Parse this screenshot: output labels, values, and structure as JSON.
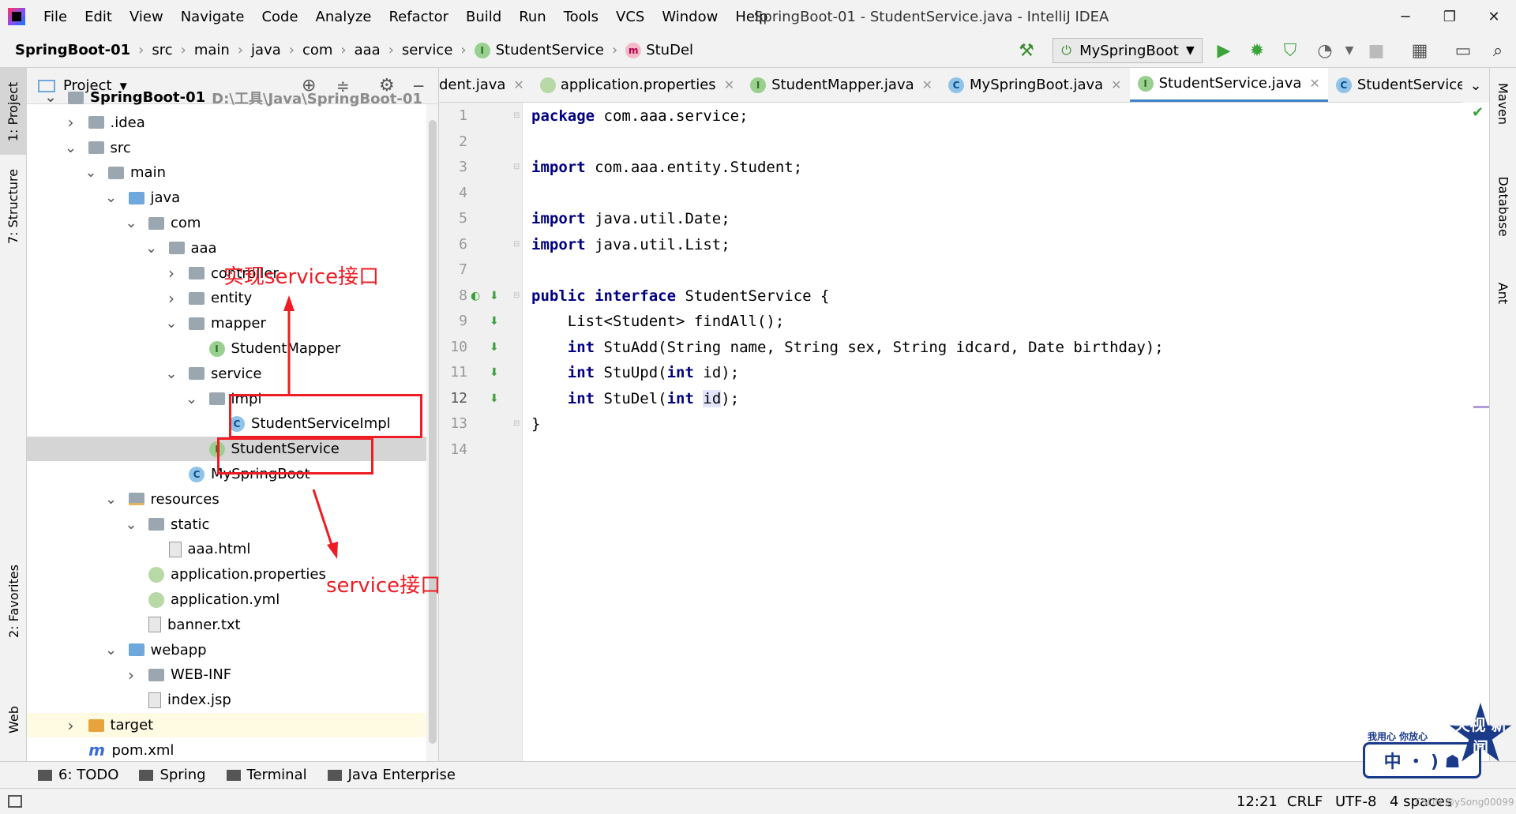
{
  "window": {
    "title": "SpringBoot-01 - StudentService.java - IntelliJ IDEA",
    "controls": {
      "minimize": "─",
      "maximize": "❐",
      "close": "✕"
    }
  },
  "menu": [
    "File",
    "Edit",
    "View",
    "Navigate",
    "Code",
    "Analyze",
    "Refactor",
    "Build",
    "Run",
    "Tools",
    "VCS",
    "Window",
    "Help"
  ],
  "breadcrumbs": {
    "project": "SpringBoot-01",
    "path": [
      "src",
      "main",
      "java",
      "com",
      "aaa",
      "service"
    ],
    "class": "StudentService",
    "method": "StuDel",
    "class_badge": "I",
    "method_badge": "m"
  },
  "toolbar": {
    "run_config": "MySpringBoot",
    "icons": [
      "hammer-icon",
      "run-icon",
      "debug-icon",
      "coverage-icon",
      "profile-icon",
      "stop-icon",
      "project-structure-icon",
      "layout-icon",
      "search-icon"
    ]
  },
  "left_tools": {
    "project": "1: Project",
    "structure": "7: Structure",
    "favorites": "2: Favorites",
    "web": "Web"
  },
  "right_tools": {
    "maven": "Maven",
    "database": "Database",
    "ant": "Ant"
  },
  "project_panel": {
    "title": "Project",
    "tree": [
      {
        "label": "SpringBoot-01",
        "hint": "D:\\工具\\Java\\SpringBoot-01",
        "depth": 0,
        "arrow": "open",
        "icon": "folder"
      },
      {
        "label": ".idea",
        "depth": 1,
        "arrow": "closed",
        "icon": "folder"
      },
      {
        "label": "src",
        "depth": 1,
        "arrow": "open",
        "icon": "folder"
      },
      {
        "label": "main",
        "depth": 2,
        "arrow": "open",
        "icon": "folder"
      },
      {
        "label": "java",
        "depth": 3,
        "arrow": "open",
        "icon": "folder-blue"
      },
      {
        "label": "com",
        "depth": 4,
        "arrow": "open",
        "icon": "folder"
      },
      {
        "label": "aaa",
        "depth": 5,
        "arrow": "open",
        "icon": "folder"
      },
      {
        "label": "controller",
        "depth": 6,
        "arrow": "closed",
        "icon": "folder"
      },
      {
        "label": "entity",
        "depth": 6,
        "arrow": "closed",
        "icon": "folder"
      },
      {
        "label": "mapper",
        "depth": 6,
        "arrow": "open",
        "icon": "folder"
      },
      {
        "label": "StudentMapper",
        "depth": 7,
        "arrow": "none",
        "icon": "interface",
        "badge": "I"
      },
      {
        "label": "service",
        "depth": 6,
        "arrow": "open",
        "icon": "folder"
      },
      {
        "label": "impl",
        "depth": 7,
        "arrow": "open",
        "icon": "folder"
      },
      {
        "label": "StudentServiceImpl",
        "depth": 8,
        "arrow": "none",
        "icon": "class",
        "badge": "C"
      },
      {
        "label": "StudentService",
        "depth": 7,
        "arrow": "none",
        "icon": "interface",
        "badge": "I",
        "selected": true
      },
      {
        "label": "MySpringBoot",
        "depth": 6,
        "arrow": "none",
        "icon": "class",
        "badge": "C"
      },
      {
        "label": "resources",
        "depth": 3,
        "arrow": "open",
        "icon": "folder-res"
      },
      {
        "label": "static",
        "depth": 4,
        "arrow": "open",
        "icon": "folder"
      },
      {
        "label": "aaa.html",
        "depth": 5,
        "arrow": "none",
        "icon": "file"
      },
      {
        "label": "application.properties",
        "depth": 4,
        "arrow": "none",
        "icon": "prop"
      },
      {
        "label": "application.yml",
        "depth": 4,
        "arrow": "none",
        "icon": "prop"
      },
      {
        "label": "banner.txt",
        "depth": 4,
        "arrow": "none",
        "icon": "file"
      },
      {
        "label": "webapp",
        "depth": 3,
        "arrow": "open",
        "icon": "folder-blue"
      },
      {
        "label": "WEB-INF",
        "depth": 4,
        "arrow": "closed",
        "icon": "folder"
      },
      {
        "label": "index.jsp",
        "depth": 4,
        "arrow": "none",
        "icon": "file"
      },
      {
        "label": "target",
        "depth": 1,
        "arrow": "closed",
        "icon": "folder-orange",
        "excluded": true
      },
      {
        "label": "pom.xml",
        "depth": 1,
        "arrow": "none",
        "icon": "xml"
      }
    ]
  },
  "editor_tabs": [
    {
      "label": "dent.java",
      "icon": "none"
    },
    {
      "label": "application.properties",
      "icon": "prop"
    },
    {
      "label": "StudentMapper.java",
      "icon": "interface",
      "badge": "I"
    },
    {
      "label": "MySpringBoot.java",
      "icon": "class",
      "badge": "C"
    },
    {
      "label": "StudentService.java",
      "icon": "interface",
      "badge": "I",
      "active": true
    },
    {
      "label": "StudentServiceImpl.java",
      "icon": "class",
      "badge": "C"
    }
  ],
  "code_lines": [
    {
      "n": "1",
      "parts": [
        [
          "kw",
          "package"
        ],
        [
          "t",
          " com.aaa.service;"
        ]
      ]
    },
    {
      "n": "2",
      "parts": []
    },
    {
      "n": "3",
      "parts": [
        [
          "kw",
          "import"
        ],
        [
          "t",
          " com.aaa.entity.Student;"
        ]
      ]
    },
    {
      "n": "4",
      "parts": []
    },
    {
      "n": "5",
      "parts": [
        [
          "kw",
          "import"
        ],
        [
          "t",
          " java.util.Date;"
        ]
      ]
    },
    {
      "n": "6",
      "parts": [
        [
          "kw",
          "import"
        ],
        [
          "t",
          " java.util.List;"
        ]
      ]
    },
    {
      "n": "7",
      "parts": []
    },
    {
      "n": "8",
      "parts": [
        [
          "kw",
          "public interface"
        ],
        [
          "t",
          " StudentService {"
        ]
      ]
    },
    {
      "n": "9",
      "parts": [
        [
          "t",
          "    List<Student> findAll();"
        ]
      ]
    },
    {
      "n": "10",
      "parts": [
        [
          "t",
          "    "
        ],
        [
          "kw",
          "int"
        ],
        [
          "t",
          " StuAdd(String name, String sex, String idcard, Date birthday);"
        ]
      ]
    },
    {
      "n": "11",
      "parts": [
        [
          "t",
          "    "
        ],
        [
          "kw",
          "int"
        ],
        [
          "t",
          " StuUpd("
        ],
        [
          "kw",
          "int"
        ],
        [
          "t",
          " id);"
        ]
      ]
    },
    {
      "n": "12",
      "parts": [
        [
          "t",
          "    "
        ],
        [
          "kw",
          "int"
        ],
        [
          "t",
          " StuDel("
        ],
        [
          "kw",
          "int"
        ],
        [
          "t",
          " "
        ],
        [
          "hl",
          "id"
        ],
        [
          "t",
          ");"
        ]
      ]
    },
    {
      "n": "13",
      "parts": [
        [
          "t",
          "}"
        ]
      ]
    },
    {
      "n": "14",
      "parts": []
    }
  ],
  "bottom_tools": [
    {
      "label": "6: TODO",
      "icon": "todo-icon"
    },
    {
      "label": "Spring",
      "icon": "spring-icon"
    },
    {
      "label": "Terminal",
      "icon": "terminal-icon"
    },
    {
      "label": "Java Enterprise",
      "icon": "java-enterprise-icon"
    }
  ],
  "status": {
    "position": "12:21",
    "line_sep": "CRLF",
    "encoding": "UTF-8",
    "indent": "4 spaces",
    "credit": "CSDN @ySong00099"
  },
  "annotations": {
    "impl_label": "实现service接口",
    "iface_label": "service接口",
    "color": "#ee1c24"
  },
  "watermark": {
    "slogan": "我用心 你放心",
    "logo": "中 ・ ) ☗",
    "badge": "央视 新闻"
  }
}
